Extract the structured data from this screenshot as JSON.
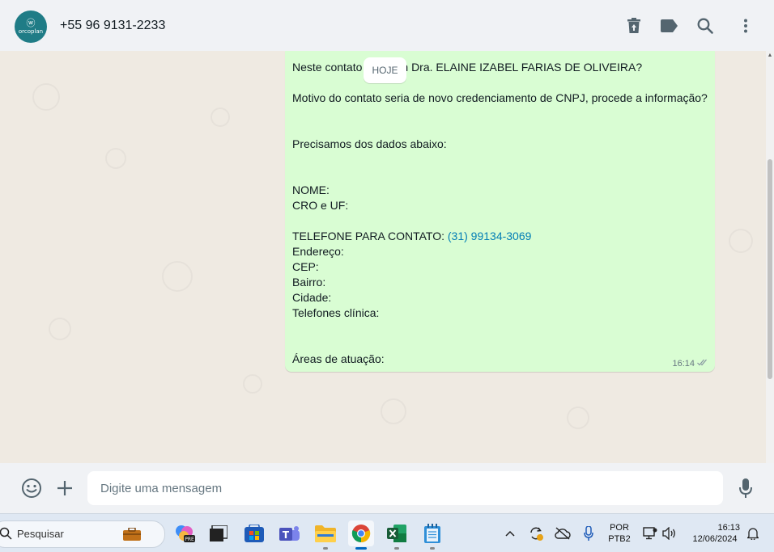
{
  "header": {
    "avatar_line1": "ⓦ",
    "avatar_line2": "orcoplan",
    "contact_name": "+55 96 9131-2233",
    "icons": [
      "delete-icon",
      "label-icon",
      "search-icon",
      "menu-icon"
    ]
  },
  "chat": {
    "date_separator": "HOJE",
    "message": {
      "line_1": "Neste contato falo com Dra. ELAINE IZABEL FARIAS DE OLIVEIRA?",
      "line_2": "Motivo do contato seria de novo credenciamento de CNPJ, procede a informação?",
      "line_3": "Precisamos dos dados abaixo:",
      "line_nome": "NOME:",
      "line_cro": "CRO e UF:",
      "line_tel_label": "TELEFONE PARA CONTATO: ",
      "line_tel_number": "(31) 99134-3069",
      "line_endereco": "Endereço:",
      "line_cep": "CEP:",
      "line_bairro": "Bairro:",
      "line_cidade": "Cidade:",
      "line_telefones": "Telefones clínica:",
      "line_areas": "Áreas de atuação:",
      "time": "16:14",
      "status": "read"
    }
  },
  "footer": {
    "placeholder": "Digite uma mensagem",
    "icons": [
      "emoji-icon",
      "plus-icon",
      "microphone-icon"
    ]
  },
  "taskbar": {
    "search_label": "Pesquisar",
    "apps": [
      "copilot",
      "task-view",
      "microsoft-store",
      "teams",
      "file-explorer",
      "chrome",
      "excel",
      "notepad"
    ],
    "language_line1": "POR",
    "language_line2": "PTB2",
    "time": "16:13",
    "date": "12/06/2024"
  },
  "colors": {
    "bubble": "#d9fdd3",
    "chat_bg": "#efeae2",
    "link": "#027eb5",
    "avatar": "#1f7c86",
    "read_ticks": "#53bdeb"
  }
}
